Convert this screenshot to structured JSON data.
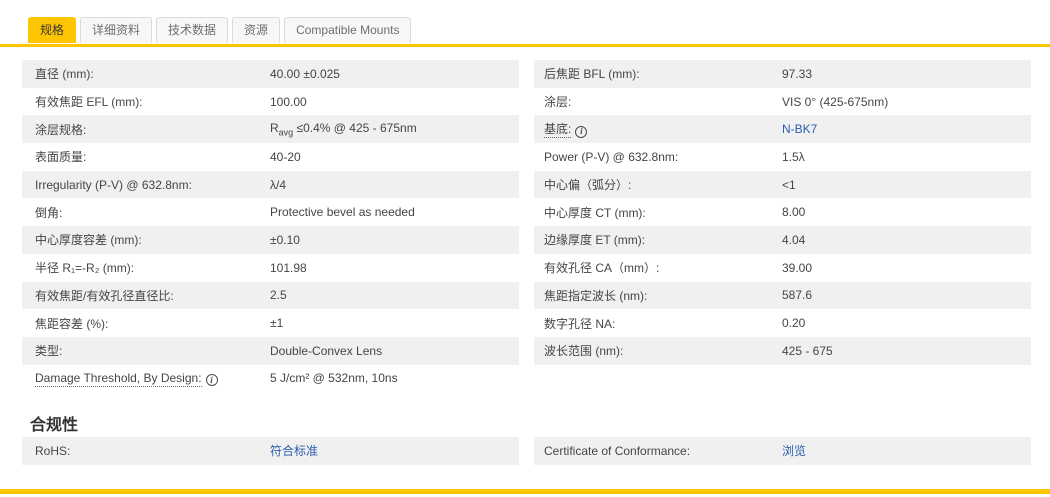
{
  "colors": {
    "accent_yellow": "#fdc500",
    "link_blue": "#2a5db0",
    "row_stripe_gray": "#f0f0f0"
  },
  "icons": {
    "info_glyph": "i"
  },
  "tabs": [
    {
      "label": "规格",
      "active": true
    },
    {
      "label": "详细资料",
      "active": false
    },
    {
      "label": "技术数据",
      "active": false
    },
    {
      "label": "资源",
      "active": false
    },
    {
      "label": "Compatible Mounts",
      "active": false
    }
  ],
  "spec": {
    "left": [
      {
        "label": "直径 (mm):",
        "value": "40.00 ±0.025"
      },
      {
        "label": "有效焦距 EFL (mm):",
        "value": "100.00"
      },
      {
        "label": "涂层规格:",
        "value_html": "R<sub>avg</sub> ≤0.4% @ 425 - 675nm"
      },
      {
        "label": "表面质量:",
        "value": "40-20"
      },
      {
        "label": "Irregularity (P-V) @ 632.8nm:",
        "value": "λ/4"
      },
      {
        "label": "倒角:",
        "value": "Protective bevel as needed"
      },
      {
        "label": "中心厚度容差 (mm):",
        "value": "±0.10"
      },
      {
        "label": "半径 R₁=-R₂ (mm):",
        "value": "101.98"
      },
      {
        "label": "有效焦距/有效孔径直径比:",
        "value": "2.5"
      },
      {
        "label": "焦距容差 (%):",
        "value": "±1"
      },
      {
        "label": "类型:",
        "value": "Double-Convex Lens"
      },
      {
        "label": "Damage Threshold, By Design:",
        "value": "5 J/cm² @ 532nm, 10ns",
        "has_info_icon": true
      }
    ],
    "right": [
      {
        "label": "后焦距 BFL (mm):",
        "value": "97.33"
      },
      {
        "label": "涂层:",
        "value": "VIS 0° (425-675nm)"
      },
      {
        "label": "基底:",
        "value": "N-BK7",
        "has_info_icon": true,
        "value_is_link": true
      },
      {
        "label": "Power (P-V) @ 632.8nm:",
        "value": "1.5λ"
      },
      {
        "label": "中心偏（弧分）:",
        "value": "<1"
      },
      {
        "label": "中心厚度 CT (mm):",
        "value": "8.00"
      },
      {
        "label": "边缘厚度 ET (mm):",
        "value": "4.04"
      },
      {
        "label": "有效孔径 CA（mm）:",
        "value": "39.00"
      },
      {
        "label": "焦距指定波长 (nm):",
        "value": "587.6"
      },
      {
        "label": "数字孔径 NA:",
        "value": "0.20"
      },
      {
        "label": "波长范围 (nm):",
        "value": "425 - 675"
      }
    ]
  },
  "compliance": {
    "heading": "合规性",
    "rows": [
      {
        "label": "RoHS:",
        "value": "符合标准",
        "value_is_link": true
      },
      {
        "label": "Certificate of Conformance:",
        "value": "浏览",
        "value_is_link": true
      }
    ]
  }
}
